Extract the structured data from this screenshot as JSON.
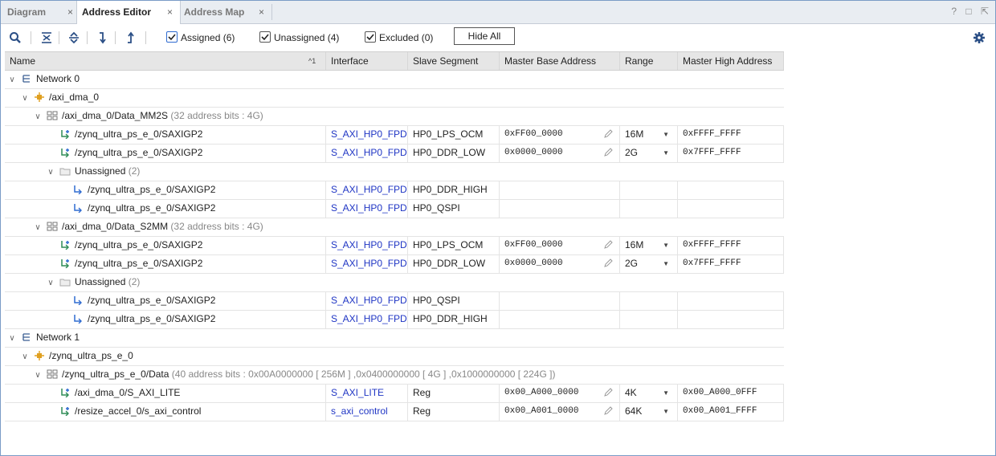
{
  "tabs": [
    {
      "label": "Diagram",
      "active": false
    },
    {
      "label": "Address Editor",
      "active": true
    },
    {
      "label": "Address Map",
      "active": false
    }
  ],
  "tab_close_glyph": "×",
  "window_controls": {
    "help": "?",
    "restore": "□",
    "float": "⇱"
  },
  "toolbar": {
    "assigned_label": "Assigned (6)",
    "unassigned_label": "Unassigned (4)",
    "excluded_label": "Excluded (0)",
    "hide_all_label": "Hide All",
    "icons": [
      "search-icon",
      "collapse-all-icon",
      "expand-all-icon",
      "assign-icon",
      "unassign-icon",
      "gear-icon"
    ]
  },
  "columns": {
    "name": "Name",
    "sort_indicator": "^1",
    "interface": "Interface",
    "slave_segment": "Slave Segment",
    "master_base_address": "Master Base Address",
    "range": "Range",
    "master_high_address": "Master High Address"
  },
  "rows": [
    {
      "name": "Network 0",
      "meta": "",
      "level": 0,
      "kind": "network",
      "expanded": true
    },
    {
      "name": "/axi_dma_0",
      "meta": "",
      "level": 1,
      "kind": "ip",
      "expanded": true
    },
    {
      "name": "/axi_dma_0/Data_MM2S",
      "meta": "(32 address bits : 4G)",
      "level": 2,
      "kind": "space",
      "expanded": true
    },
    {
      "name": "/zynq_ultra_ps_e_0/SAXIGP2",
      "level": 3,
      "kind": "assigned",
      "interface": "S_AXI_HP0_FPD",
      "segment": "HP0_LPS_OCM",
      "base": "0xFF00_0000",
      "range": "16M",
      "high": "0xFFFF_FFFF"
    },
    {
      "name": "/zynq_ultra_ps_e_0/SAXIGP2",
      "level": 3,
      "kind": "assigned",
      "interface": "S_AXI_HP0_FPD",
      "segment": "HP0_DDR_LOW",
      "base": "0x0000_0000",
      "range": "2G",
      "high": "0x7FFF_FFFF"
    },
    {
      "name": "Unassigned",
      "meta": "(2)",
      "level": 3,
      "kind": "folder",
      "expanded": true
    },
    {
      "name": "/zynq_ultra_ps_e_0/SAXIGP2",
      "level": 4,
      "kind": "unassigned",
      "interface": "S_AXI_HP0_FPD",
      "segment": "HP0_DDR_HIGH"
    },
    {
      "name": "/zynq_ultra_ps_e_0/SAXIGP2",
      "level": 4,
      "kind": "unassigned",
      "interface": "S_AXI_HP0_FPD",
      "segment": "HP0_QSPI"
    },
    {
      "name": "/axi_dma_0/Data_S2MM",
      "meta": "(32 address bits : 4G)",
      "level": 2,
      "kind": "space",
      "expanded": true
    },
    {
      "name": "/zynq_ultra_ps_e_0/SAXIGP2",
      "level": 3,
      "kind": "assigned",
      "interface": "S_AXI_HP0_FPD",
      "segment": "HP0_LPS_OCM",
      "base": "0xFF00_0000",
      "range": "16M",
      "high": "0xFFFF_FFFF"
    },
    {
      "name": "/zynq_ultra_ps_e_0/SAXIGP2",
      "level": 3,
      "kind": "assigned",
      "interface": "S_AXI_HP0_FPD",
      "segment": "HP0_DDR_LOW",
      "base": "0x0000_0000",
      "range": "2G",
      "high": "0x7FFF_FFFF"
    },
    {
      "name": "Unassigned",
      "meta": "(2)",
      "level": 3,
      "kind": "folder",
      "expanded": true
    },
    {
      "name": "/zynq_ultra_ps_e_0/SAXIGP2",
      "level": 4,
      "kind": "unassigned",
      "interface": "S_AXI_HP0_FPD",
      "segment": "HP0_QSPI"
    },
    {
      "name": "/zynq_ultra_ps_e_0/SAXIGP2",
      "level": 4,
      "kind": "unassigned",
      "interface": "S_AXI_HP0_FPD",
      "segment": "HP0_DDR_HIGH"
    },
    {
      "name": "Network 1",
      "meta": "",
      "level": 0,
      "kind": "network",
      "expanded": true
    },
    {
      "name": "/zynq_ultra_ps_e_0",
      "meta": "",
      "level": 1,
      "kind": "ip",
      "expanded": true
    },
    {
      "name": "/zynq_ultra_ps_e_0/Data",
      "meta": "(40 address bits : 0x00A0000000 [ 256M ] ,0x0400000000 [ 4G ] ,0x1000000000 [ 224G ])",
      "level": 2,
      "kind": "space",
      "expanded": true
    },
    {
      "name": "/axi_dma_0/S_AXI_LITE",
      "level": 3,
      "kind": "assigned",
      "interface": "S_AXI_LITE",
      "segment": "Reg",
      "base": "0x00_A000_0000",
      "range": "4K",
      "high": "0x00_A000_0FFF"
    },
    {
      "name": "/resize_accel_0/s_axi_control",
      "level": 3,
      "kind": "assigned",
      "interface": "s_axi_control",
      "segment": "Reg",
      "base": "0x00_A001_0000",
      "range": "64K",
      "high": "0x00_A001_FFFF"
    }
  ],
  "expand_glyph": "∨",
  "colors": {
    "link": "#1f35c4",
    "accent": "#2f6bd0",
    "border": "#7a9cc6",
    "assigned_icon": "#2e8b57",
    "unassigned_icon": "#2f6bd0",
    "ip_icon": "#e0a020"
  }
}
